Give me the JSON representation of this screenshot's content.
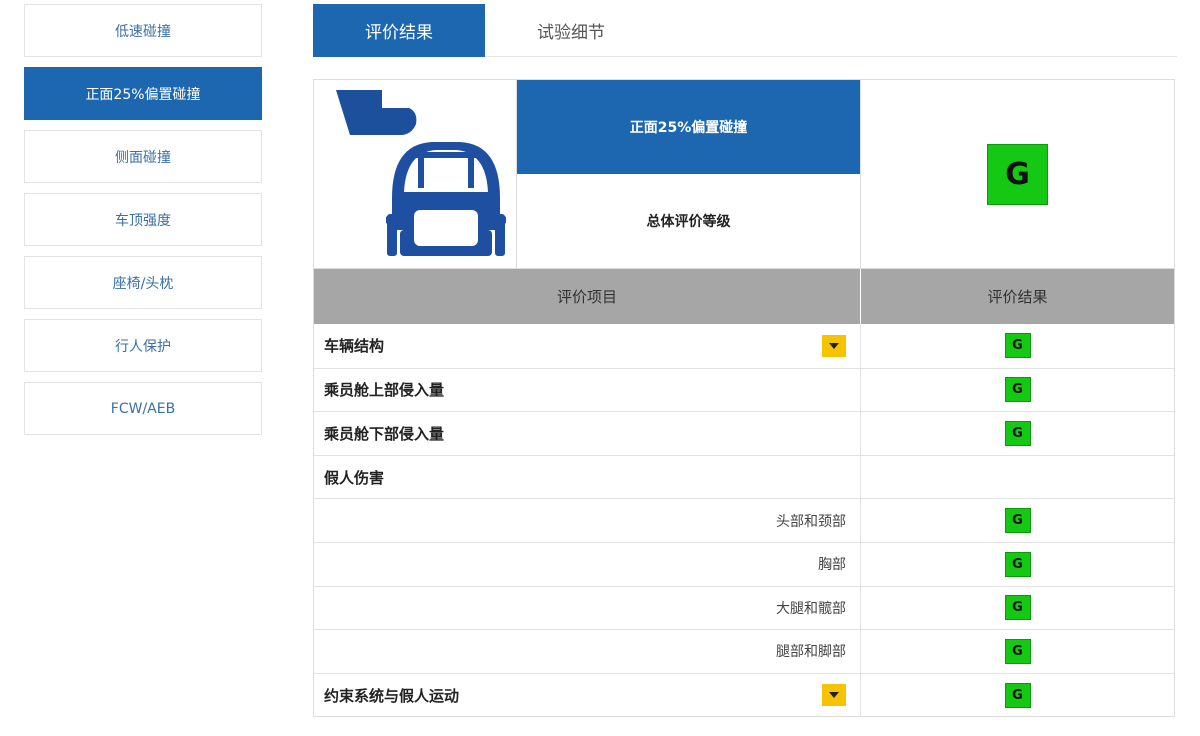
{
  "sidebar": {
    "items": [
      {
        "label": "低速碰撞",
        "active": false
      },
      {
        "label": "正面25%偏置碰撞",
        "active": true
      },
      {
        "label": "侧面碰撞",
        "active": false
      },
      {
        "label": "车顶强度",
        "active": false
      },
      {
        "label": "座椅/头枕",
        "active": false
      },
      {
        "label": "行人保护",
        "active": false
      },
      {
        "label": "FCW/AEB",
        "active": false
      }
    ]
  },
  "tabs": [
    {
      "label": "评价结果",
      "active": true
    },
    {
      "label": "试验细节",
      "active": false
    }
  ],
  "summary": {
    "test_name": "正面25%偏置碰撞",
    "overall_label": "总体评价等级",
    "overall_rating": "G"
  },
  "table": {
    "col_item": "评价项目",
    "col_result": "评价结果",
    "rows": [
      {
        "label": "车辆结构",
        "type": "bold",
        "expandable": true,
        "rating": "G"
      },
      {
        "label": "乘员舱上部侵入量",
        "type": "bold",
        "expandable": false,
        "rating": "G"
      },
      {
        "label": "乘员舱下部侵入量",
        "type": "bold",
        "expandable": false,
        "rating": "G"
      },
      {
        "label": "假人伤害",
        "type": "bold",
        "expandable": false,
        "rating": ""
      },
      {
        "label": "头部和颈部",
        "type": "sub",
        "expandable": false,
        "rating": "G"
      },
      {
        "label": "胸部",
        "type": "sub",
        "expandable": false,
        "rating": "G"
      },
      {
        "label": "大腿和髋部",
        "type": "sub",
        "expandable": false,
        "rating": "G"
      },
      {
        "label": "腿部和脚部",
        "type": "sub",
        "expandable": false,
        "rating": "G"
      },
      {
        "label": "约束系统与假人运动",
        "type": "bold",
        "expandable": true,
        "rating": "G"
      }
    ]
  },
  "colors": {
    "brand_blue": "#1d67b1",
    "rating_good": "#14c814",
    "expand_yellow": "#f7c300",
    "header_gray": "#a6a6a6"
  },
  "icons": {
    "illustration": "offset-crash-barrier-car-icon",
    "expand": "chevron-down-icon"
  }
}
